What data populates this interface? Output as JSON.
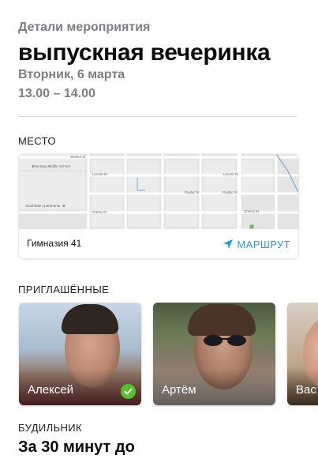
{
  "event": {
    "eyebrow": "Детали мероприятия",
    "title": "выпускная вечеринка",
    "date": "Вторник, 6 марта",
    "time": "13.00 – 14.00"
  },
  "place": {
    "section_label": "МЕСТО",
    "name": "Гимназия 41",
    "route_label": "МАРШРУТ",
    "route_icon": "navigation-arrow-icon",
    "accent_color": "#2b9bd8",
    "map_labels": {
      "school": "Syringa Middle School",
      "apartments": "Southdale Apartments",
      "walnut": "Walnut St",
      "locust_1": "Locust St",
      "locust_2": "Locust St",
      "poplar_1": "Poplar St",
      "poplar_2": "Poplar St",
      "cherry_1": "Cherry St",
      "cherry_2": "Cherry St"
    }
  },
  "invited": {
    "section_label": "ПРИГЛАШЁННЫЕ",
    "people": [
      {
        "name": "Алексей",
        "confirmed": true,
        "badge_icon": "checkmark-icon",
        "badge_color": "#58c02f"
      },
      {
        "name": "Артём",
        "confirmed": false
      },
      {
        "name": "Вас"
      }
    ]
  },
  "alarm": {
    "section_label": "БУДИЛЬНИК",
    "value": "За 30 минут до"
  }
}
